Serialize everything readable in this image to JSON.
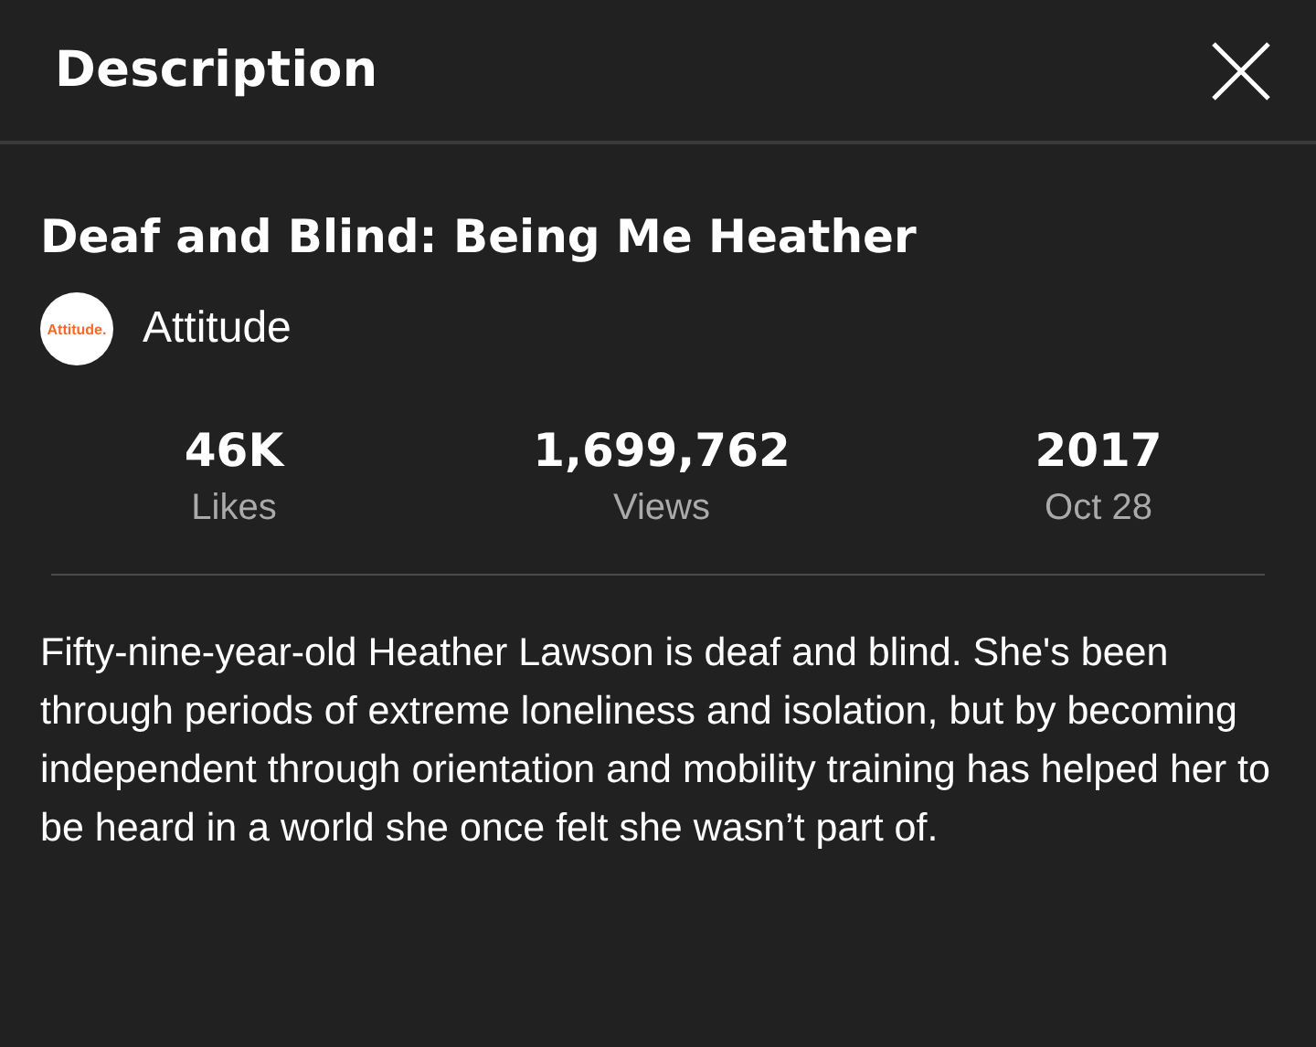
{
  "header": {
    "title": "Description"
  },
  "video": {
    "title": "Deaf and Blind: Being Me Heather"
  },
  "channel": {
    "logo_text": "Attitude.",
    "name": "Attitude"
  },
  "stats": [
    {
      "value": "46K",
      "label": "Likes"
    },
    {
      "value": "1,699,762",
      "label": "Views"
    },
    {
      "value": "2017",
      "label": "Oct 28"
    }
  ],
  "description": "Fifty-nine-year-old Heather Lawson is deaf and blind. She's been through periods of extreme loneliness and isolation, but by becoming independent through orientation and mobility training has helped her to be heard in a world she once felt she wasn’t part of."
}
